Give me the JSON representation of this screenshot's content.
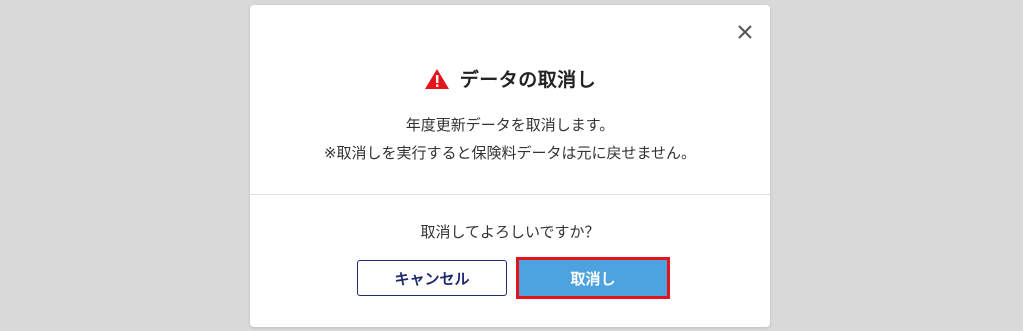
{
  "dialog": {
    "close_icon": "close-icon",
    "warning_icon": "warning-triangle-icon",
    "warning_color": "#e3141a",
    "title": "データの取消し",
    "message_line1": "年度更新データを取消します。",
    "message_line2": "※取消しを実行すると保険料データは元に戻せません。",
    "question": "取消してよろしいですか？",
    "cancel_label": "キャンセル",
    "confirm_label": "取消し",
    "confirm_color": "#4da3e0",
    "cancel_border_color": "#1d2b6b"
  }
}
